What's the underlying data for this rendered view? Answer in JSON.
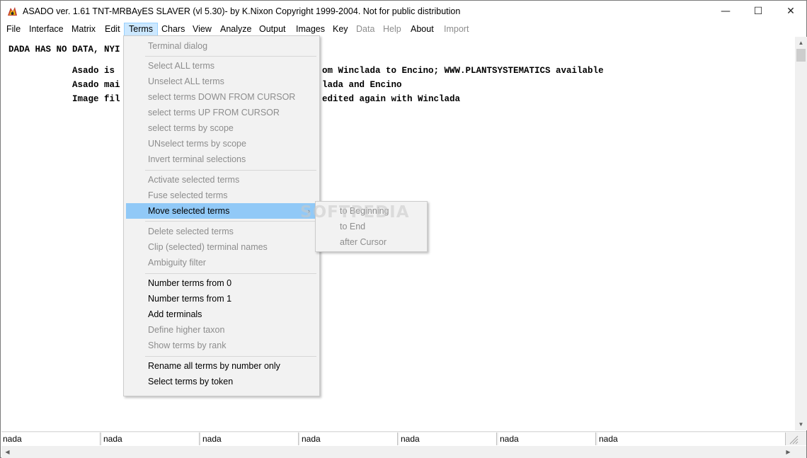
{
  "titlebar": {
    "title": "ASADO ver. 1.61 TNT-MRBAyES SLAVER (vl 5.30)- by K.Nixon Copyright 1999-2004. Not for public distribution",
    "app_icon": "asado-app-icon",
    "minimize": "—",
    "maximize": "☐",
    "close": "✕"
  },
  "menubar": {
    "items": [
      {
        "label": "File",
        "enabled": true
      },
      {
        "label": "Interface",
        "enabled": true
      },
      {
        "label": "Matrix",
        "enabled": true
      },
      {
        "label": "Edit",
        "enabled": true
      },
      {
        "label": "Terms",
        "enabled": true,
        "open": true
      },
      {
        "label": "Chars",
        "enabled": true
      },
      {
        "label": "View",
        "enabled": true
      },
      {
        "label": "Analyze",
        "enabled": true
      },
      {
        "label": "Output",
        "enabled": true
      },
      {
        "label": "Images",
        "enabled": true
      },
      {
        "label": "Key",
        "enabled": true
      },
      {
        "label": "Data",
        "enabled": false
      },
      {
        "label": "Help",
        "enabled": false
      },
      {
        "label": "About",
        "enabled": true
      },
      {
        "label": "Import",
        "enabled": false
      }
    ]
  },
  "content": {
    "line1": "DADA HAS NO DATA, NYI",
    "line2": "Asado is",
    "line2b": "om Winclada to Encino; WWW.PLANTSYSTEMATICS available",
    "line3": "Asado mai",
    "line3b": "lada and Encino",
    "line4": "Image fil",
    "line4b": "edited again with Winclada"
  },
  "terms_menu": {
    "items": [
      {
        "label": "Terminal dialog",
        "enabled": false
      },
      {
        "label": "Select ALL terms",
        "enabled": false
      },
      {
        "label": "Unselect ALL terms",
        "enabled": false
      },
      {
        "label": "select terms DOWN FROM CURSOR",
        "enabled": false
      },
      {
        "label": "select terms UP FROM CURSOR",
        "enabled": false
      },
      {
        "label": "select terms by scope",
        "enabled": false
      },
      {
        "label": "UNselect terms by scope",
        "enabled": false
      },
      {
        "label": "Invert terminal selections",
        "enabled": false
      },
      {
        "label": "Activate selected terms",
        "enabled": false
      },
      {
        "label": "Fuse selected terms",
        "enabled": false
      },
      {
        "label": "Move selected terms",
        "enabled": true,
        "highlighted": true,
        "submenu": true
      },
      {
        "label": "Delete selected terms",
        "enabled": false
      },
      {
        "label": "Clip (selected) terminal names",
        "enabled": false
      },
      {
        "label": "Ambiguity filter",
        "enabled": false
      },
      {
        "label": "Number terms from 0",
        "enabled": true
      },
      {
        "label": "Number terms from 1",
        "enabled": true
      },
      {
        "label": "Add terminals",
        "enabled": true
      },
      {
        "label": "Define higher taxon",
        "enabled": false
      },
      {
        "label": "Show terms by rank",
        "enabled": false
      },
      {
        "label": "Rename all terms by number only",
        "enabled": true
      },
      {
        "label": "Select terms by token",
        "enabled": true
      }
    ],
    "submenu_arrow": "›"
  },
  "move_submenu": {
    "items": [
      {
        "label": "to Beginning",
        "enabled": false
      },
      {
        "label": "to End",
        "enabled": false
      },
      {
        "label": "after Cursor",
        "enabled": false
      }
    ]
  },
  "watermark": "SOFTPEDIA",
  "statusbar": {
    "cells": [
      "nada",
      "nada",
      "nada",
      "nada",
      "nada",
      "nada",
      "nada"
    ]
  },
  "colors": {
    "menu_highlight": "#91c9f7",
    "menubar_active": "#cce8ff",
    "disabled_text": "#8d8d8d"
  }
}
